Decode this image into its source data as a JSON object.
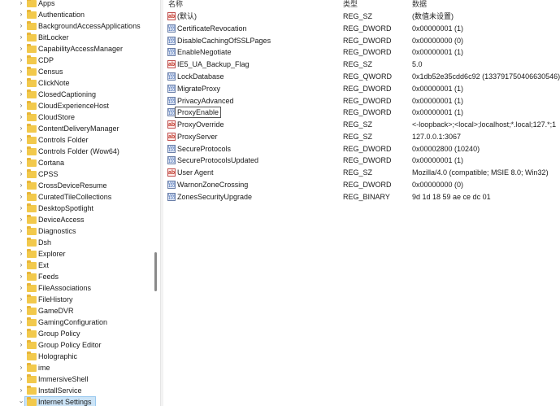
{
  "tree": {
    "items": [
      {
        "label": "Apps"
      },
      {
        "label": "Authentication"
      },
      {
        "label": "BackgroundAccessApplications"
      },
      {
        "label": "BitLocker"
      },
      {
        "label": "CapabilityAccessManager"
      },
      {
        "label": "CDP"
      },
      {
        "label": "Census"
      },
      {
        "label": "ClickNote"
      },
      {
        "label": "ClosedCaptioning"
      },
      {
        "label": "CloudExperienceHost"
      },
      {
        "label": "CloudStore"
      },
      {
        "label": "ContentDeliveryManager"
      },
      {
        "label": "Controls Folder"
      },
      {
        "label": "Controls Folder (Wow64)"
      },
      {
        "label": "Cortana"
      },
      {
        "label": "CPSS"
      },
      {
        "label": "CrossDeviceResume"
      },
      {
        "label": "CuratedTileCollections"
      },
      {
        "label": "DesktopSpotlight"
      },
      {
        "label": "DeviceAccess"
      },
      {
        "label": "Diagnostics"
      },
      {
        "label": "Dsh"
      },
      {
        "label": "Explorer"
      },
      {
        "label": "Ext"
      },
      {
        "label": "Feeds"
      },
      {
        "label": "FileAssociations"
      },
      {
        "label": "FileHistory"
      },
      {
        "label": "GameDVR"
      },
      {
        "label": "GamingConfiguration"
      },
      {
        "label": "Group Policy"
      },
      {
        "label": "Group Policy Editor"
      },
      {
        "label": "Holographic"
      },
      {
        "label": "ime"
      },
      {
        "label": "ImmersiveShell"
      },
      {
        "label": "InstallService"
      },
      {
        "label": "Internet Settings"
      }
    ]
  },
  "list": {
    "headers": {
      "name": "名称",
      "type": "类型",
      "data": "数据"
    },
    "values": [
      {
        "name": "(默认)",
        "type": "REG_SZ",
        "data": "(数值未设置)",
        "icon": "string-value-icon"
      },
      {
        "name": "CertificateRevocation",
        "type": "REG_DWORD",
        "data": "0x00000001 (1)",
        "icon": "binary-value-icon"
      },
      {
        "name": "DisableCachingOfSSLPages",
        "type": "REG_DWORD",
        "data": "0x00000000 (0)",
        "icon": "binary-value-icon"
      },
      {
        "name": "EnableNegotiate",
        "type": "REG_DWORD",
        "data": "0x00000001 (1)",
        "icon": "binary-value-icon"
      },
      {
        "name": "IE5_UA_Backup_Flag",
        "type": "REG_SZ",
        "data": "5.0",
        "icon": "string-value-icon"
      },
      {
        "name": "LockDatabase",
        "type": "REG_QWORD",
        "data": "0x1db52e35cdd6c92 (133791750406630546)",
        "icon": "binary-value-icon"
      },
      {
        "name": "MigrateProxy",
        "type": "REG_DWORD",
        "data": "0x00000001 (1)",
        "icon": "binary-value-icon"
      },
      {
        "name": "PrivacyAdvanced",
        "type": "REG_DWORD",
        "data": "0x00000001 (1)",
        "icon": "binary-value-icon"
      },
      {
        "name": "ProxyEnable",
        "type": "REG_DWORD",
        "data": "0x00000001 (1)",
        "icon": "binary-value-icon"
      },
      {
        "name": "ProxyOverride",
        "type": "REG_SZ",
        "data": "<-loopback>;<local>;localhost;*.local;127.*;1",
        "icon": "string-value-icon"
      },
      {
        "name": "ProxyServer",
        "type": "REG_SZ",
        "data": "127.0.0.1:3067",
        "icon": "string-value-icon"
      },
      {
        "name": "SecureProtocols",
        "type": "REG_DWORD",
        "data": "0x00002800 (10240)",
        "icon": "binary-value-icon"
      },
      {
        "name": "SecureProtocolsUpdated",
        "type": "REG_DWORD",
        "data": "0x00000001 (1)",
        "icon": "binary-value-icon"
      },
      {
        "name": "User Agent",
        "type": "REG_SZ",
        "data": "Mozilla/4.0 (compatible; MSIE 8.0; Win32)",
        "icon": "string-value-icon"
      },
      {
        "name": "WarnonZoneCrossing",
        "type": "REG_DWORD",
        "data": "0x00000000 (0)",
        "icon": "binary-value-icon"
      },
      {
        "name": "ZonesSecurityUpgrade",
        "type": "REG_BINARY",
        "data": "9d 1d 18 59 ae ce dc 01",
        "icon": "binary-value-icon"
      }
    ]
  }
}
